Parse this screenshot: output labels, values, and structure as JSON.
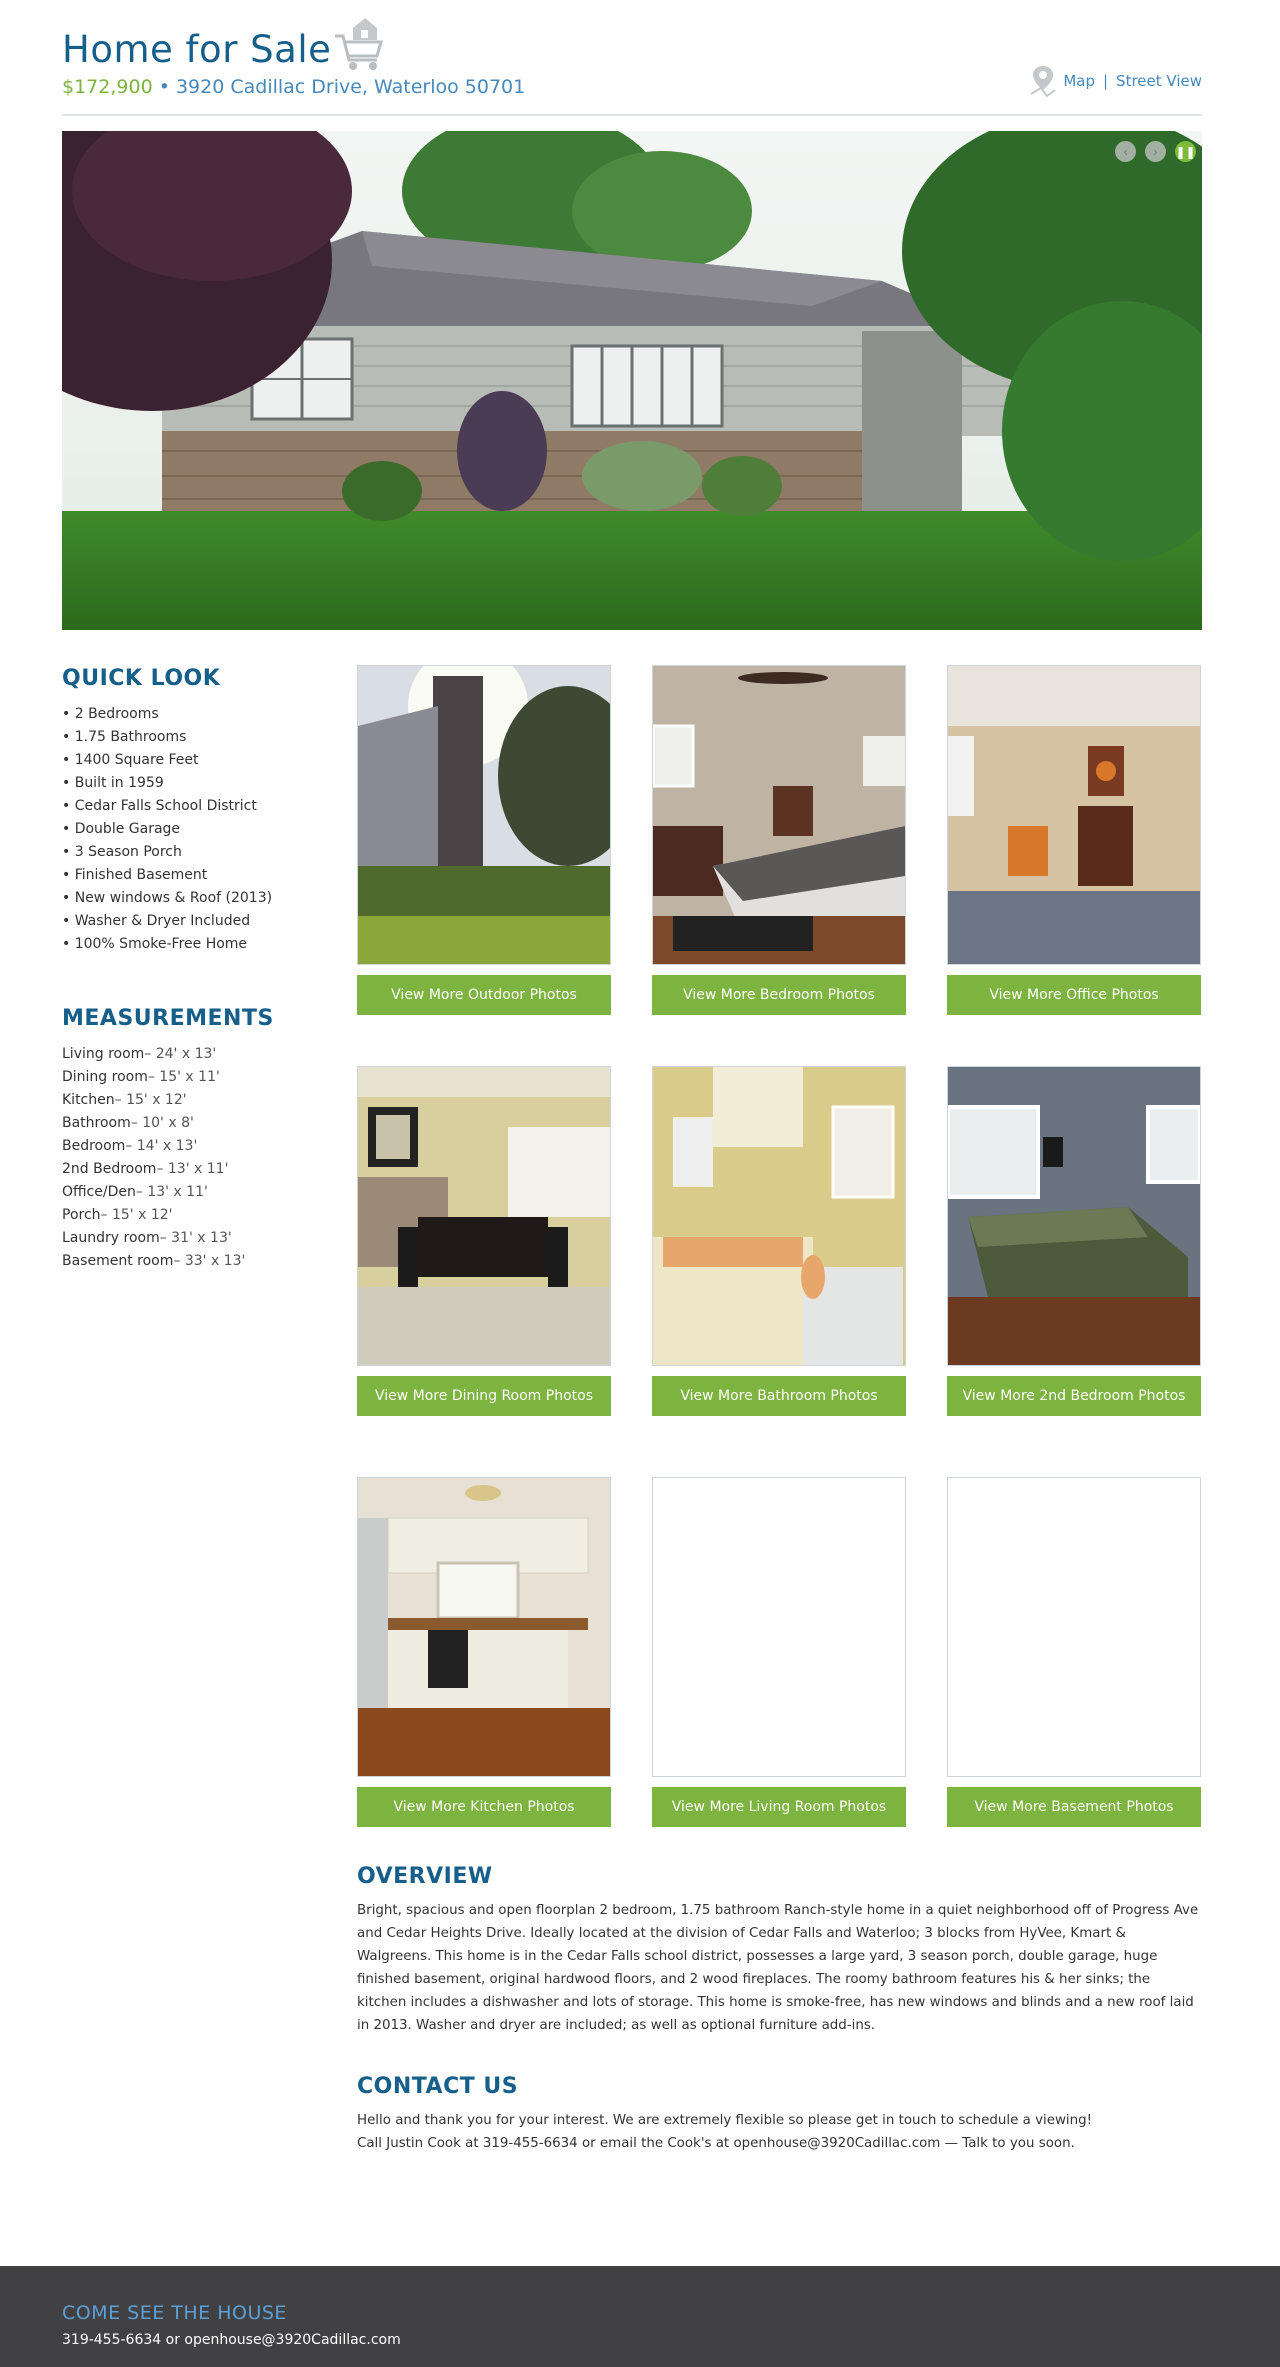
{
  "header": {
    "title": "Home for Sale",
    "price": "$172,900",
    "bullet": " • ",
    "address": "3920 Cadillac Drive, Waterloo 50701",
    "map_link": "Map",
    "divider": "|",
    "street_view_link": "Street View"
  },
  "slider": {
    "prev_icon": "chevron-left-icon",
    "next_icon": "chevron-right-icon",
    "pause_icon": "pause-icon"
  },
  "quick_look": {
    "heading": "QUICK LOOK",
    "items": [
      "• 2 Bedrooms",
      "• 1.75 Bathrooms",
      "• 1400 Square Feet",
      "• Built in 1959",
      "• Cedar Falls School District",
      "• Double Garage",
      "• 3 Season Porch",
      "• Finished Basement",
      "• New windows & Roof (2013)",
      "• Washer & Dryer Included",
      "• 100% Smoke-Free Home"
    ]
  },
  "measurements": {
    "heading": "MEASUREMENTS",
    "items": [
      {
        "room": "Living room",
        "dim": "– 24' x 13'"
      },
      {
        "room": "Dining room",
        "dim": "– 15' x 11'"
      },
      {
        "room": "Kitchen",
        "dim": "– 15' x 12'"
      },
      {
        "room": "Bathroom",
        "dim": "– 10' x 8'"
      },
      {
        "room": "Bedroom",
        "dim": "– 14' x 13'"
      },
      {
        "room": "2nd Bedroom",
        "dim": "– 13' x 11'"
      },
      {
        "room": "Office/Den",
        "dim": "– 13' x 11'"
      },
      {
        "room": "Porch",
        "dim": "– 15' x 12'"
      },
      {
        "room": "Laundry room",
        "dim": "– 31' x 13'"
      },
      {
        "room": "Basement room",
        "dim": "– 33' x 13'"
      }
    ]
  },
  "gallery": [
    {
      "button": "View More Outdoor Photos"
    },
    {
      "button": "View More Bedroom Photos"
    },
    {
      "button": "View More Office Photos"
    },
    {
      "button": "View More Dining Room Photos"
    },
    {
      "button": "View More Bathroom Photos"
    },
    {
      "button": "View More 2nd Bedroom Photos"
    },
    {
      "button": "View More Kitchen Photos"
    },
    {
      "button": "View More Living Room Photos"
    },
    {
      "button": "View More Basement Photos"
    }
  ],
  "overview": {
    "heading": "OVERVIEW",
    "text": "Bright, spacious and open floorplan 2 bedroom, 1.75 bathroom Ranch-style home in a quiet neighborhood off of Progress Ave and Cedar Heights Drive. Ideally located at the division of Cedar Falls and Waterloo; 3 blocks from HyVee, Kmart & Walgreens. This home is in the Cedar Falls school district, possesses a large yard, 3 season porch, double garage, huge finished basement, original hardwood floors, and 2 wood fireplaces. The roomy bathroom features his & her sinks; the kitchen includes a dishwasher and lots of storage. This home is smoke-free, has new windows and blinds and a new roof laid in 2013. Washer and dryer are included; as well as optional furniture add-ins."
  },
  "contact": {
    "heading": "CONTACT US",
    "line1": "Hello and thank you for your interest. We are extremely flexible so please get in touch to schedule a viewing!",
    "line2": "Call Justin Cook at 319-455-6634 or email the Cook's at openhouse@3920Cadillac.com — Talk to you soon."
  },
  "footer": {
    "title": "COME SEE THE HOUSE",
    "subtitle": "319-455-6634 or openhouse@3920Cadillac.com"
  },
  "colors": {
    "brand_blue": "#155f8a",
    "link_blue": "#4589bd",
    "accent_green": "#7db33f",
    "footer_bg": "#414143"
  }
}
